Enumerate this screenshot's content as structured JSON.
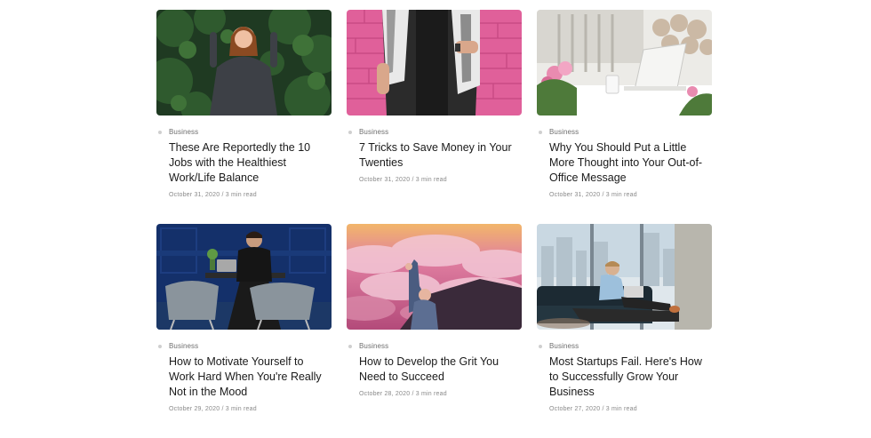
{
  "posts": [
    {
      "category": "Business",
      "title": "These Are Reportedly the 10 Jobs with the Healthiest Work/Life Balance",
      "date": "October 31, 2020",
      "read": "3 min read",
      "image": "woman-in-foliage"
    },
    {
      "category": "Business",
      "title": "7 Tricks to Save Money in Your Twenties",
      "date": "October 31, 2020",
      "read": "3 min read",
      "image": "person-pink-brick-wall"
    },
    {
      "category": "Business",
      "title": "Why You Should Put a Little More Thought into Your Out-of-Office Message",
      "date": "October 31, 2020",
      "read": "3 min read",
      "image": "laptop-on-balcony-table"
    },
    {
      "category": "Business",
      "title": "How to Motivate Yourself to Work Hard When You're Really Not in the Mood",
      "date": "October 29, 2020",
      "read": "3 min read",
      "image": "man-at-desk-blue-room"
    },
    {
      "category": "Business",
      "title": "How to Develop the Grit You Need to Succeed",
      "date": "October 28, 2020",
      "read": "3 min read",
      "image": "hiker-above-clouds"
    },
    {
      "category": "Business",
      "title": "Most Startups Fail. Here's How to Successfully Grow Your Business",
      "date": "October 27, 2020",
      "read": "3 min read",
      "image": "man-on-sofa-city-view"
    }
  ],
  "separator": "/"
}
